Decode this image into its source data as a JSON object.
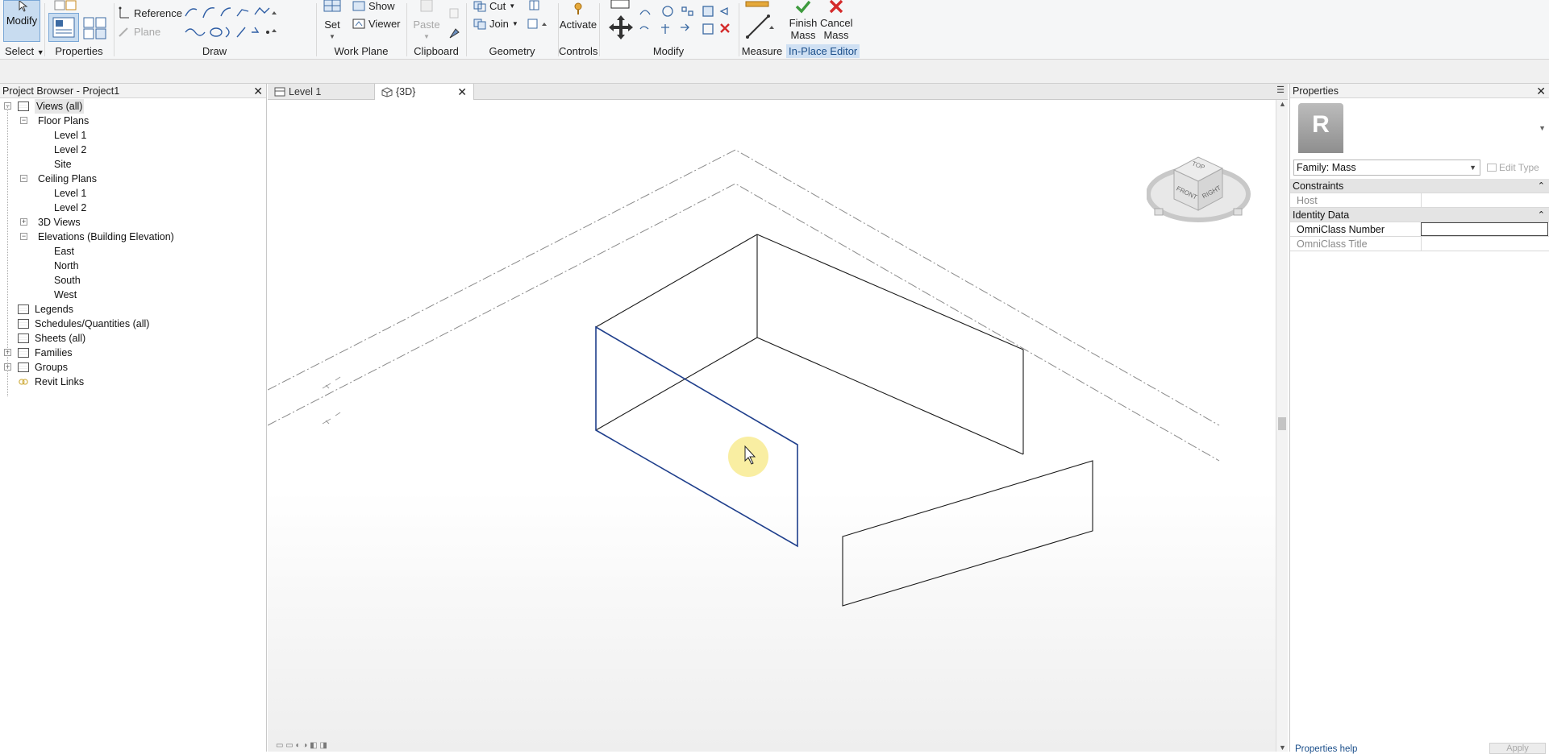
{
  "ribbon": {
    "select": {
      "modify_label": "Modify",
      "panel_label": "Select"
    },
    "properties": {
      "panel_label": "Properties"
    },
    "draw": {
      "panel_label": "Draw",
      "reference_label": "Reference",
      "plane_label": "Plane"
    },
    "work_plane": {
      "panel_label": "Work Plane",
      "set_label": "Set",
      "show_label": "Show",
      "viewer_label": "Viewer"
    },
    "clipboard": {
      "panel_label": "Clipboard",
      "paste_label": "Paste"
    },
    "geometry": {
      "panel_label": "Geometry",
      "cut_label": "Cut",
      "join_label": "Join"
    },
    "controls": {
      "panel_label": "Controls",
      "activate_label": "Activate"
    },
    "modify": {
      "panel_label": "Modify"
    },
    "measure": {
      "panel_label": "Measure"
    },
    "in_place_editor": {
      "panel_label": "In-Place Editor",
      "finish_label_1": "Finish",
      "finish_label_2": "Mass",
      "cancel_label_1": "Cancel",
      "cancel_label_2": "Mass"
    }
  },
  "project_browser": {
    "title": "Project Browser - Project1",
    "items": [
      {
        "label": "Views (all)",
        "level": 0
      },
      {
        "label": "Floor Plans",
        "level": 1
      },
      {
        "label": "Level 1",
        "level": 2
      },
      {
        "label": "Level 2",
        "level": 2
      },
      {
        "label": "Site",
        "level": 2
      },
      {
        "label": "Ceiling Plans",
        "level": 1
      },
      {
        "label": "Level 1",
        "level": 2
      },
      {
        "label": "Level 2",
        "level": 2
      },
      {
        "label": "3D Views",
        "level": 1
      },
      {
        "label": "Elevations (Building Elevation)",
        "level": 1
      },
      {
        "label": "East",
        "level": 2
      },
      {
        "label": "North",
        "level": 2
      },
      {
        "label": "South",
        "level": 2
      },
      {
        "label": "West",
        "level": 2
      },
      {
        "label": "Legends",
        "level": 0
      },
      {
        "label": "Schedules/Quantities (all)",
        "level": 0
      },
      {
        "label": "Sheets (all)",
        "level": 0
      },
      {
        "label": "Families",
        "level": 0
      },
      {
        "label": "Groups",
        "level": 0
      },
      {
        "label": "Revit Links",
        "level": 0
      }
    ]
  },
  "view_tabs": [
    {
      "label": "Level 1",
      "active": false
    },
    {
      "label": "{3D}",
      "active": true
    }
  ],
  "viewcube": {
    "top": "TOP",
    "front": "FRONT",
    "right": "RIGHT"
  },
  "properties": {
    "title": "Properties",
    "type_selector": "Family: Mass",
    "edit_type_label": "Edit Type",
    "groups": [
      {
        "label": "Constraints",
        "rows": [
          {
            "name": "Host",
            "value": ""
          }
        ]
      },
      {
        "label": "Identity Data",
        "rows": [
          {
            "name": "OmniClass Number",
            "value": ""
          },
          {
            "name": "OmniClass Title",
            "value": ""
          }
        ]
      }
    ],
    "help_link": "Properties help",
    "apply_label": "Apply"
  },
  "colors": {
    "accent": "#1a4e8a",
    "selection": "#1f3f8c",
    "ribbon_bg": "#f5f6f7"
  }
}
